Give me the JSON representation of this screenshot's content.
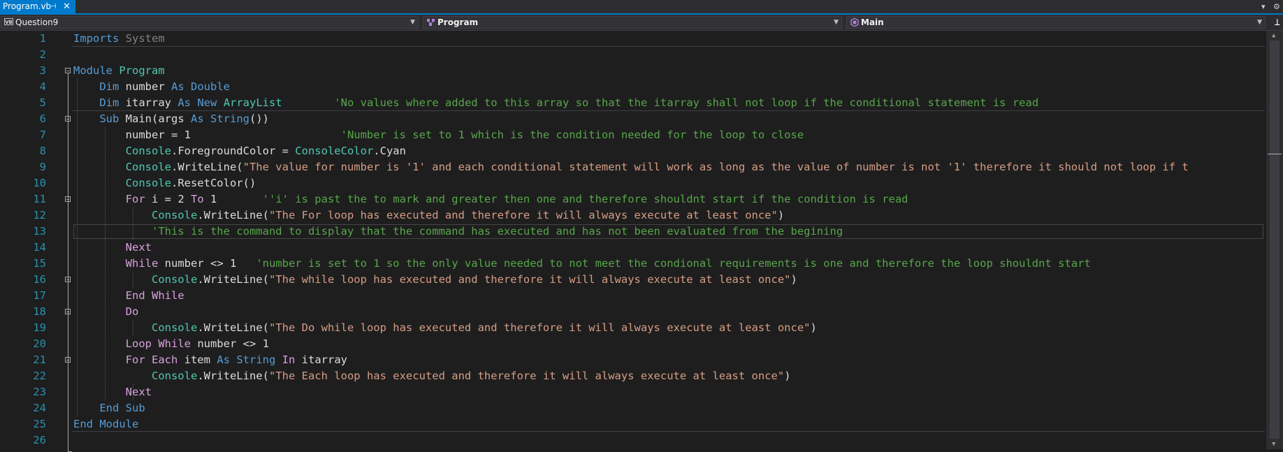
{
  "tab": {
    "title": "Program.vb",
    "pin": "⊣",
    "close": "✕"
  },
  "tabstrip_right": {
    "dropdown": "▾",
    "settings": "⚙"
  },
  "navbar": {
    "project": "Question9",
    "project_icon": "VB",
    "type": "Program",
    "member": "Main",
    "split": "⊥"
  },
  "line_numbers": [
    "1",
    "2",
    "3",
    "4",
    "5",
    "6",
    "7",
    "8",
    "9",
    "10",
    "11",
    "12",
    "13",
    "14",
    "15",
    "16",
    "17",
    "18",
    "19",
    "20",
    "21",
    "22",
    "23",
    "24",
    "25",
    "26"
  ],
  "code": {
    "l1": {
      "a": "Imports",
      "b": " System"
    },
    "l3": {
      "a": "Module",
      "b": " Program"
    },
    "l4": {
      "ind": "    ",
      "a": "Dim",
      "b": " number ",
      "c": "As",
      "d": " ",
      "e": "Double"
    },
    "l5": {
      "ind": "    ",
      "a": "Dim",
      "b": " itarray ",
      "c": "As",
      "d": " ",
      "e": "New",
      "f": " ",
      "g": "ArrayList",
      "h": "        ",
      "cm": "'No values where added to this array so that the itarray shall not loop if the conditional statement is read"
    },
    "l6": {
      "ind": "    ",
      "a": "Sub",
      "b": " Main(args ",
      "c": "As",
      "d": " ",
      "e": "String",
      "f": "())"
    },
    "l7": {
      "ind": "        ",
      "b": "number = 1                       ",
      "cm": "'Number is set to 1 which is the condition needed for the loop to close"
    },
    "l8": {
      "ind": "        ",
      "a": "Console",
      "b": ".ForegroundColor = ",
      "c": "ConsoleColor",
      "d": ".Cyan"
    },
    "l9": {
      "ind": "        ",
      "a": "Console",
      "b": ".WriteLine(",
      "str": "\"The value for number is '1' and each conditional statement will work as long as the value of number is not '1' therefore it should not loop if t"
    },
    "l10": {
      "ind": "        ",
      "a": "Console",
      "b": ".ResetColor()"
    },
    "l11": {
      "ind": "        ",
      "a": "For",
      "b": " i = 2 ",
      "c": "To",
      "d": " 1       ",
      "cm": "''i' is past the to mark and greater then one and therefore shouldnt start if the condition is read"
    },
    "l12": {
      "ind": "            ",
      "a": "Console",
      "b": ".WriteLine(",
      "str": "\"The For loop has executed and therefore it will always execute at least once\"",
      "e": ")"
    },
    "l13": {
      "ind": "            ",
      "cm": "'This is the command to display that the command has executed and has not been evaluated from the begining"
    },
    "l14": {
      "ind": "        ",
      "a": "Next"
    },
    "l15": {
      "ind": "        ",
      "a": "While",
      "b": " number <> 1   ",
      "cm": "'number is set to 1 so the only value needed to not meet the condional requirements is one and therefore the loop shouldnt start"
    },
    "l16": {
      "ind": "            ",
      "a": "Console",
      "b": ".WriteLine(",
      "str": "\"The while loop has executed and therefore it will always execute at least once\"",
      "e": ")"
    },
    "l17": {
      "ind": "        ",
      "a": "End While"
    },
    "l18": {
      "ind": "        ",
      "a": "Do"
    },
    "l19": {
      "ind": "            ",
      "a": "Console",
      "b": ".WriteLine(",
      "str": "\"The Do while loop has executed and therefore it will always execute at least once\"",
      "e": ")"
    },
    "l20": {
      "ind": "        ",
      "a": "Loop While",
      "b": " number <> 1"
    },
    "l21": {
      "ind": "        ",
      "a": "For Each",
      "b": " item ",
      "c": "As",
      "d": " ",
      "e": "String",
      "f": " ",
      "g": "In",
      "h": " itarray"
    },
    "l22": {
      "ind": "            ",
      "a": "Console",
      "b": ".WriteLine(",
      "str": "\"The Each loop has executed and therefore it will always execute at least once\"",
      "e": ")"
    },
    "l23": {
      "ind": "        ",
      "a": "Next"
    },
    "l24": {
      "ind": "    ",
      "a": "End Sub"
    },
    "l25": {
      "a": "End Module"
    }
  },
  "colors": {
    "keyword": "#569cd6",
    "control_keyword": "#d8a0df",
    "type": "#4ec9b0",
    "string": "#d69d85",
    "comment": "#57a64a",
    "line_number": "#2b91af",
    "accent": "#007acc"
  }
}
